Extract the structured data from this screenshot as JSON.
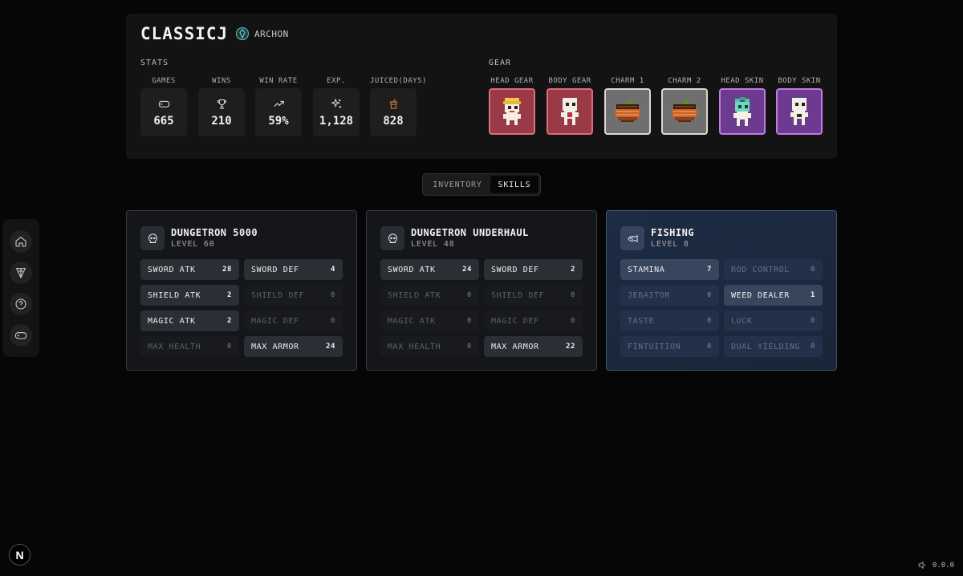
{
  "sidebar": {
    "items": [
      {
        "icon": "home-icon"
      },
      {
        "icon": "trophy-cone-icon"
      },
      {
        "icon": "help-icon"
      },
      {
        "icon": "gamepad-icon"
      }
    ]
  },
  "profile": {
    "username": "CLASSICJ",
    "rank": "ARCHON",
    "stats_title": "STATS",
    "gear_title": "GEAR",
    "stats": [
      {
        "label": "GAMES",
        "value": "665",
        "icon": "gamepad-icon"
      },
      {
        "label": "WINS",
        "value": "210",
        "icon": "trophy-icon"
      },
      {
        "label": "WIN RATE",
        "value": "59%",
        "icon": "trending-up-icon"
      },
      {
        "label": "EXP.",
        "value": "1,128",
        "icon": "sparkles-icon"
      },
      {
        "label": "JUICED(DAYS)",
        "value": "828",
        "icon": "juice-cup-icon"
      }
    ],
    "gear": [
      {
        "label": "HEAD GEAR",
        "rarity_color": "#e06b7b"
      },
      {
        "label": "BODY GEAR",
        "rarity_color": "#e06b7b"
      },
      {
        "label": "CHARM 1",
        "rarity_color": "#d8d8d8"
      },
      {
        "label": "CHARM 2",
        "rarity_color": "#d8d8d8"
      },
      {
        "label": "HEAD SKIN",
        "rarity_color": "#c07ae6"
      },
      {
        "label": "BODY SKIN",
        "rarity_color": "#c07ae6"
      }
    ]
  },
  "tabs": {
    "inventory": "INVENTORY",
    "skills": "SKILLS",
    "active": "SKILLS"
  },
  "skills": [
    {
      "name": "DUNGETRON 5000",
      "level": "LEVEL 60",
      "icon": "skull-icon",
      "attributes": [
        {
          "name": "SWORD ATK",
          "value": "28"
        },
        {
          "name": "SWORD DEF",
          "value": "4"
        },
        {
          "name": "SHIELD ATK",
          "value": "2"
        },
        {
          "name": "SHIELD DEF",
          "value": "0"
        },
        {
          "name": "MAGIC ATK",
          "value": "2"
        },
        {
          "name": "MAGIC DEF",
          "value": "0"
        },
        {
          "name": "MAX HEALTH",
          "value": "0"
        },
        {
          "name": "MAX ARMOR",
          "value": "24"
        }
      ]
    },
    {
      "name": "DUNGETRON UNDERHAUL",
      "level": "LEVEL 48",
      "icon": "skull-icon",
      "attributes": [
        {
          "name": "SWORD ATK",
          "value": "24"
        },
        {
          "name": "SWORD DEF",
          "value": "2"
        },
        {
          "name": "SHIELD ATK",
          "value": "0"
        },
        {
          "name": "SHIELD DEF",
          "value": "0"
        },
        {
          "name": "MAGIC ATK",
          "value": "0"
        },
        {
          "name": "MAGIC DEF",
          "value": "0"
        },
        {
          "name": "MAX HEALTH",
          "value": "0"
        },
        {
          "name": "MAX ARMOR",
          "value": "22"
        }
      ]
    },
    {
      "name": "FISHING",
      "level": "LEVEL 8",
      "icon": "fish-icon",
      "attributes": [
        {
          "name": "STAMINA",
          "value": "7"
        },
        {
          "name": "ROD CONTROL",
          "value": "0"
        },
        {
          "name": "JEBAITOR",
          "value": "0"
        },
        {
          "name": "WEED DEALER",
          "value": "1"
        },
        {
          "name": "TASTE",
          "value": "0"
        },
        {
          "name": "LUCK",
          "value": "0"
        },
        {
          "name": "FINTUITION",
          "value": "0"
        },
        {
          "name": "DUAL YIELDING",
          "value": "0"
        }
      ]
    }
  ],
  "footer": {
    "logo": "N",
    "version": "0.0.0"
  }
}
